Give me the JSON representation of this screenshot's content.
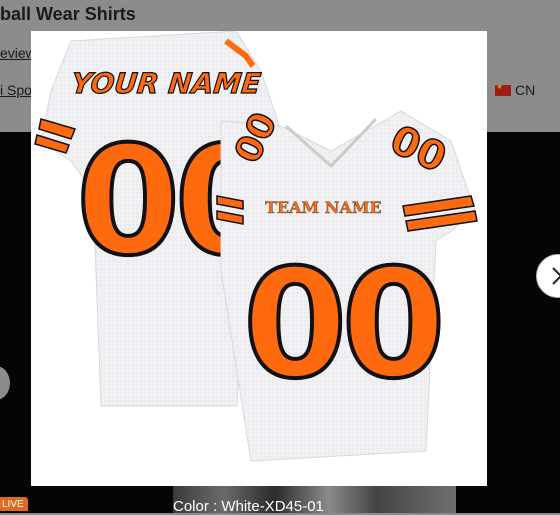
{
  "background": {
    "product_title": "ball Wear Shirts",
    "review_link": "eview",
    "shop_link": "i Spo",
    "country_code": "CN",
    "live_badge": "LIVE",
    "color_label": "Color : White-XD45-01"
  },
  "modal": {
    "jersey": {
      "back_name": "YOUR NAME",
      "back_number": "00",
      "front_team": "TEAM NAME",
      "front_number": "00",
      "sleeve_number": "00"
    }
  },
  "colors": {
    "primary": "#ff6a0f",
    "outline": "#111111",
    "jersey": "#f4f4f6",
    "overlay": "#000000"
  },
  "icons": {
    "next": "chevron-right-icon",
    "prev": "chevron-left-icon",
    "flag": "china-flag-icon"
  }
}
